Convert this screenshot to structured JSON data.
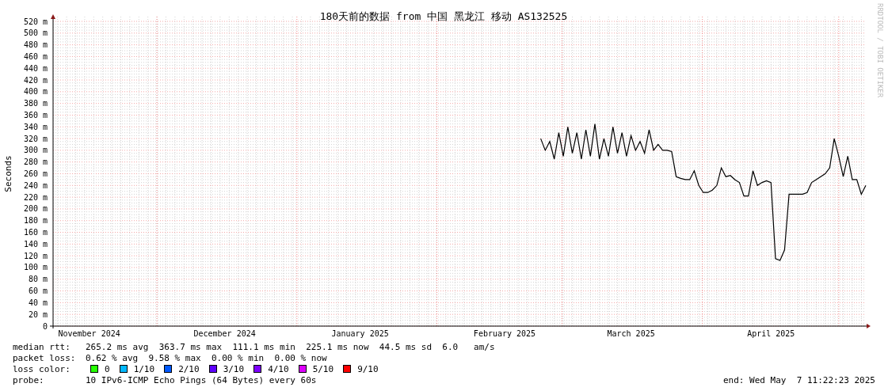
{
  "chart": {
    "watermark": "RRDTOOL / TOBI OETIKER",
    "chart_data": {
      "type": "line",
      "title": "180天前的数据 from 中国 黑龙江 移动 AS132525",
      "ylabel": "Seconds",
      "ylim": [
        0,
        520
      ],
      "grid": true,
      "yticks": [
        {
          "value": 0,
          "label": "0"
        },
        {
          "value": 20,
          "label": "20 m"
        },
        {
          "value": 40,
          "label": "40 m"
        },
        {
          "value": 60,
          "label": "60 m"
        },
        {
          "value": 80,
          "label": "80 m"
        },
        {
          "value": 100,
          "label": "100 m"
        },
        {
          "value": 120,
          "label": "120 m"
        },
        {
          "value": 140,
          "label": "140 m"
        },
        {
          "value": 160,
          "label": "160 m"
        },
        {
          "value": 180,
          "label": "180 m"
        },
        {
          "value": 200,
          "label": "200 m"
        },
        {
          "value": 220,
          "label": "220 m"
        },
        {
          "value": 240,
          "label": "240 m"
        },
        {
          "value": 260,
          "label": "260 m"
        },
        {
          "value": 280,
          "label": "280 m"
        },
        {
          "value": 300,
          "label": "300 m"
        },
        {
          "value": 320,
          "label": "320 m"
        },
        {
          "value": 340,
          "label": "340 m"
        },
        {
          "value": 360,
          "label": "360 m"
        },
        {
          "value": 380,
          "label": "380 m"
        },
        {
          "value": 400,
          "label": "400 m"
        },
        {
          "value": 420,
          "label": "420 m"
        },
        {
          "value": 440,
          "label": "440 m"
        },
        {
          "value": 460,
          "label": "460 m"
        },
        {
          "value": 480,
          "label": "480 m"
        },
        {
          "value": 500,
          "label": "500 m"
        },
        {
          "value": 520,
          "label": "520 m"
        }
      ],
      "categories": [
        null,
        null,
        null,
        null,
        null,
        null,
        null,
        null,
        "November 2024",
        null,
        null,
        null,
        null,
        null,
        null,
        null,
        null,
        null,
        null,
        null,
        null,
        null,
        null,
        null,
        null,
        null,
        null,
        null,
        null,
        null,
        null,
        null,
        null,
        null,
        null,
        null,
        null,
        null,
        "December 2024",
        null,
        null,
        null,
        null,
        null,
        null,
        null,
        null,
        null,
        null,
        null,
        null,
        null,
        null,
        null,
        null,
        null,
        null,
        null,
        null,
        null,
        null,
        null,
        null,
        null,
        null,
        null,
        null,
        null,
        "January 2025",
        null,
        null,
        null,
        null,
        null,
        null,
        null,
        null,
        null,
        null,
        null,
        null,
        null,
        null,
        null,
        null,
        null,
        null,
        null,
        null,
        null,
        null,
        null,
        null,
        null,
        null,
        null,
        null,
        null,
        null,
        null,
        "February 2025",
        null,
        null,
        null,
        null,
        null,
        null,
        null,
        null,
        null,
        null,
        null,
        null,
        null,
        null,
        null,
        null,
        null,
        null,
        null,
        null,
        null,
        null,
        null,
        null,
        null,
        null,
        null,
        "March 2025",
        null,
        null,
        null,
        null,
        null,
        null,
        null,
        null,
        null,
        null,
        null,
        null,
        null,
        null,
        null,
        null,
        null,
        null,
        null,
        null,
        null,
        null,
        null,
        null,
        null,
        null,
        null,
        null,
        null,
        null,
        "April 2025",
        null,
        null,
        null,
        null,
        null,
        null,
        null,
        null,
        null,
        null,
        null,
        null,
        null,
        null,
        null,
        null,
        null,
        null,
        null,
        null,
        null
      ],
      "series": [
        {
          "name": "median rtt:",
          "color": "#000000",
          "values": [
            null,
            null,
            null,
            null,
            null,
            null,
            null,
            null,
            null,
            null,
            null,
            null,
            null,
            null,
            null,
            null,
            null,
            null,
            null,
            null,
            null,
            null,
            null,
            null,
            null,
            null,
            null,
            null,
            null,
            null,
            null,
            null,
            null,
            null,
            null,
            null,
            null,
            null,
            null,
            null,
            null,
            null,
            null,
            null,
            null,
            null,
            null,
            null,
            null,
            null,
            null,
            null,
            null,
            null,
            null,
            null,
            null,
            null,
            null,
            null,
            null,
            null,
            null,
            null,
            null,
            null,
            null,
            null,
            null,
            null,
            null,
            null,
            null,
            null,
            null,
            null,
            null,
            null,
            null,
            null,
            null,
            null,
            null,
            null,
            null,
            null,
            null,
            null,
            null,
            null,
            null,
            null,
            null,
            null,
            null,
            null,
            null,
            null,
            null,
            null,
            null,
            null,
            null,
            null,
            null,
            null,
            null,
            null,
            320,
            300,
            315,
            285,
            330,
            290,
            340,
            295,
            330,
            285,
            335,
            290,
            345,
            285,
            320,
            290,
            340,
            295,
            330,
            290,
            325,
            300,
            315,
            295,
            335,
            300,
            310,
            300,
            300,
            298,
            255,
            252,
            250,
            250,
            265,
            240,
            228,
            228,
            232,
            240,
            270,
            255,
            257,
            250,
            245,
            222,
            222,
            265,
            240,
            245,
            248,
            245,
            115,
            112,
            130,
            225,
            225,
            225,
            225,
            228,
            245,
            250,
            255,
            260,
            270,
            320,
            290,
            255,
            290,
            250,
            250,
            225,
            240
          ]
        }
      ]
    }
  },
  "legend": {
    "lines": [
      {
        "value": "265.2 ms avg  363.7 ms max  111.1 ms min  225.1 ms now  44.5 ms sd  6.0   am/s"
      },
      {
        "label": "packet loss:",
        "value": "0.62 % avg  9.58 % max  0.00 % min  0.00 % now"
      }
    ],
    "loss_label": "loss color:",
    "loss_colors": [
      {
        "label": "0",
        "color": "#26ff00"
      },
      {
        "label": "1/10",
        "color": "#00b8ff"
      },
      {
        "label": "2/10",
        "color": "#0059ff"
      },
      {
        "label": "3/10",
        "color": "#5e00ff"
      },
      {
        "label": "4/10",
        "color": "#7e00ff"
      },
      {
        "label": "5/10",
        "color": "#dd00ff"
      },
      {
        "label": "9/10",
        "color": "#ff0000"
      }
    ],
    "probe_label": "probe:",
    "probe": "10 IPv6-ICMP Echo Pings (64 Bytes) every 60s",
    "end": "end: Wed May  7 11:22:23 2025"
  }
}
